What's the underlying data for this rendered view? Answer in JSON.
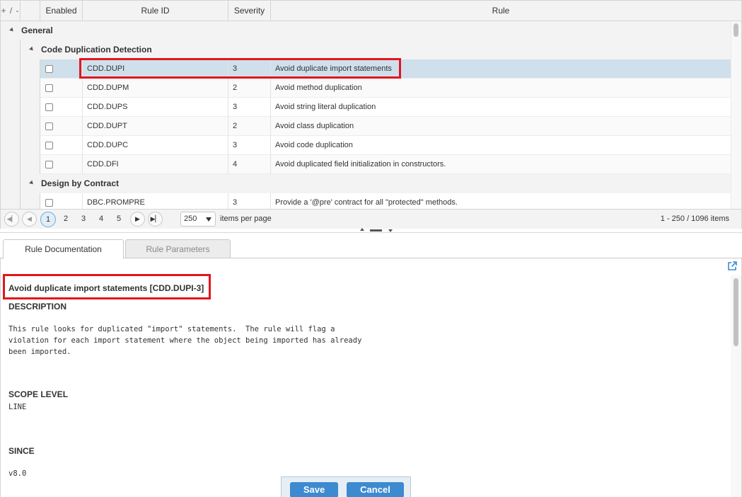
{
  "grid": {
    "toggle_label": "+ / -",
    "columns": {
      "enabled": "Enabled",
      "rule_id": "Rule ID",
      "severity": "Severity",
      "rule": "Rule"
    },
    "groups": {
      "general": "General",
      "cdd": "Code Duplication Detection",
      "dbc": "Design by Contract"
    },
    "rows": [
      {
        "id": "CDD.DUPI",
        "severity": "3",
        "rule": "Avoid duplicate import statements"
      },
      {
        "id": "CDD.DUPM",
        "severity": "2",
        "rule": "Avoid method duplication"
      },
      {
        "id": "CDD.DUPS",
        "severity": "3",
        "rule": "Avoid string literal duplication"
      },
      {
        "id": "CDD.DUPT",
        "severity": "2",
        "rule": "Avoid class duplication"
      },
      {
        "id": "CDD.DUPC",
        "severity": "3",
        "rule": "Avoid code duplication"
      },
      {
        "id": "CDD.DFI",
        "severity": "4",
        "rule": "Avoid duplicated field initialization in constructors."
      },
      {
        "id": "DBC.PROMPRE",
        "severity": "3",
        "rule": "Provide a '@pre' contract for all \"protected\" methods."
      }
    ]
  },
  "pager": {
    "pages": [
      "1",
      "2",
      "3",
      "4",
      "5"
    ],
    "per_page": "250",
    "per_page_label": "items per page",
    "count": "1 - 250 / 1096 items"
  },
  "tabs": {
    "doc": "Rule Documentation",
    "params": "Rule Parameters"
  },
  "doc": {
    "title": "Avoid duplicate import statements [CDD.DUPI-3]",
    "description_heading": "DESCRIPTION",
    "description_text": "This rule looks for duplicated \"import\" statements.  The rule will flag a\nviolation for each import statement where the object being imported has already\nbeen imported.",
    "scope_heading": "SCOPE LEVEL",
    "scope_value": "LINE",
    "since_heading": "SINCE",
    "since_value": "v8.0"
  },
  "footer": {
    "save": "Save",
    "cancel": "Cancel"
  },
  "colors": {
    "highlight": "#e2161c",
    "selected_row": "#cfdfeb",
    "button": "#3d8ad0"
  }
}
